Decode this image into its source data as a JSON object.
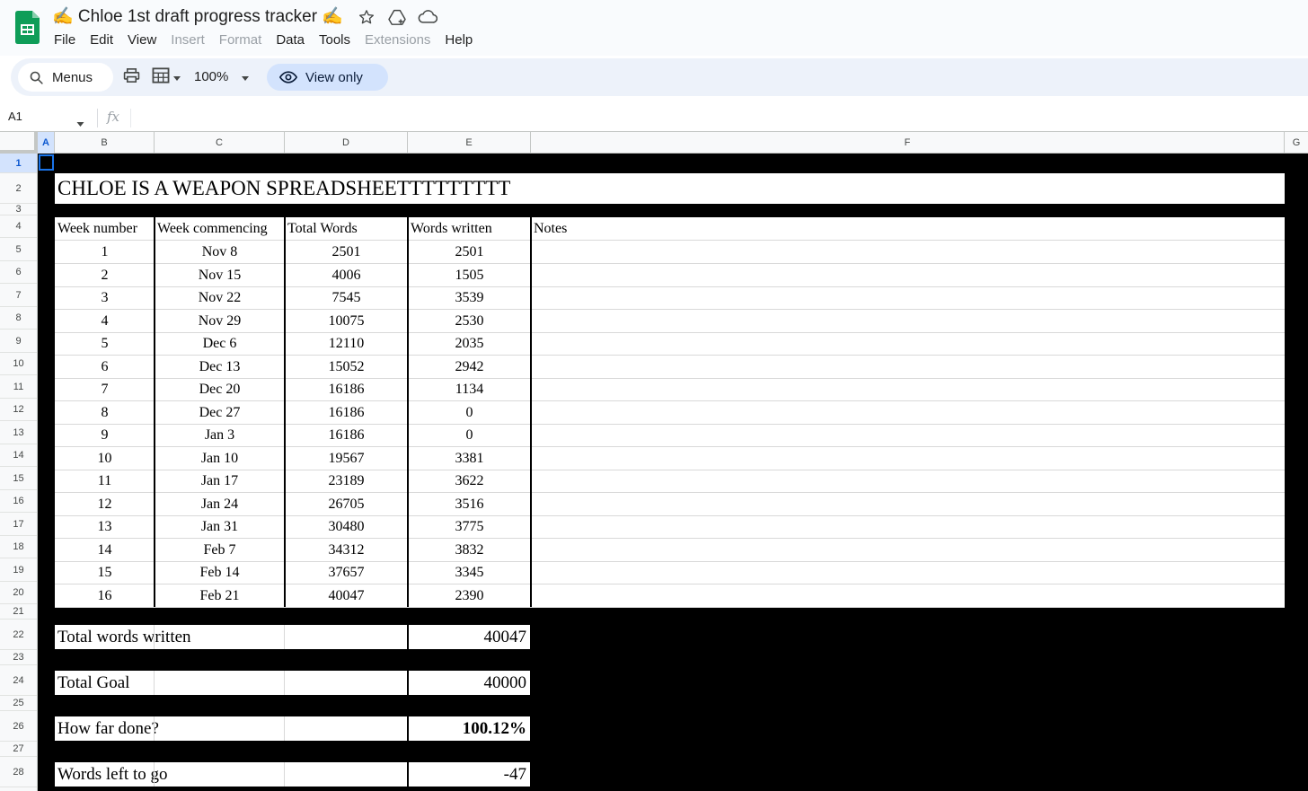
{
  "document": {
    "title": "✍️ Chloe 1st draft progress tracker ✍️"
  },
  "menu": [
    {
      "label": "File",
      "disabled": false
    },
    {
      "label": "Edit",
      "disabled": false
    },
    {
      "label": "View",
      "disabled": false
    },
    {
      "label": "Insert",
      "disabled": true
    },
    {
      "label": "Format",
      "disabled": true
    },
    {
      "label": "Data",
      "disabled": false
    },
    {
      "label": "Tools",
      "disabled": false
    },
    {
      "label": "Extensions",
      "disabled": true
    },
    {
      "label": "Help",
      "disabled": false
    }
  ],
  "toolbar": {
    "menus_label": "Menus",
    "zoom": "100%",
    "view_only_label": "View only"
  },
  "formula_bar": {
    "name_box": "A1",
    "fx": "fx"
  },
  "grid": {
    "columns": [
      "A",
      "B",
      "C",
      "D",
      "E",
      "F",
      "G"
    ],
    "selected_column": "A",
    "rows": [
      "1",
      "2",
      "3",
      "4",
      "5",
      "6",
      "7",
      "8",
      "9",
      "10",
      "11",
      "12",
      "13",
      "14",
      "15",
      "16",
      "17",
      "18",
      "19",
      "20",
      "21",
      "22",
      "23",
      "24",
      "25",
      "26",
      "27",
      "28"
    ],
    "selected_row": "1"
  },
  "sheet": {
    "title": "CHLOE IS A WEAPON SPREADSHEETTTTTTTTT",
    "headers": [
      "Week number",
      "Week commencing",
      "Total Words",
      "Words written",
      "Notes"
    ],
    "rows": [
      [
        "1",
        "Nov 8",
        "2501",
        "2501",
        ""
      ],
      [
        "2",
        "Nov 15",
        "4006",
        "1505",
        ""
      ],
      [
        "3",
        "Nov 22",
        "7545",
        "3539",
        ""
      ],
      [
        "4",
        "Nov 29",
        "10075",
        "2530",
        ""
      ],
      [
        "5",
        "Dec 6",
        "12110",
        "2035",
        ""
      ],
      [
        "6",
        "Dec 13",
        "15052",
        "2942",
        ""
      ],
      [
        "7",
        "Dec 20",
        "16186",
        "1134",
        ""
      ],
      [
        "8",
        "Dec 27",
        "16186",
        "0",
        ""
      ],
      [
        "9",
        "Jan 3",
        "16186",
        "0",
        ""
      ],
      [
        "10",
        "Jan 10",
        "19567",
        "3381",
        ""
      ],
      [
        "11",
        "Jan 17",
        "23189",
        "3622",
        ""
      ],
      [
        "12",
        "Jan 24",
        "26705",
        "3516",
        ""
      ],
      [
        "13",
        "Jan 31",
        "30480",
        "3775",
        ""
      ],
      [
        "14",
        "Feb 7",
        "34312",
        "3832",
        ""
      ],
      [
        "15",
        "Feb 14",
        "37657",
        "3345",
        ""
      ],
      [
        "16",
        "Feb 21",
        "40047",
        "2390",
        ""
      ]
    ],
    "summary": [
      {
        "label": "Total words written",
        "value": "40047",
        "bold": false
      },
      {
        "label": "Total Goal",
        "value": "40000",
        "bold": false
      },
      {
        "label": "How far done?",
        "value": "100.12%",
        "bold": true
      },
      {
        "label": "Words left to go",
        "value": "-47",
        "bold": false
      }
    ]
  },
  "colors": {
    "sheet_background": "#000000",
    "cell_background": "#ffffff",
    "selection": "#1a73e8",
    "toolbar": "#edf2fa",
    "view_only_pill": "#d3e3fd",
    "sheets_green": "#0f9d58"
  }
}
